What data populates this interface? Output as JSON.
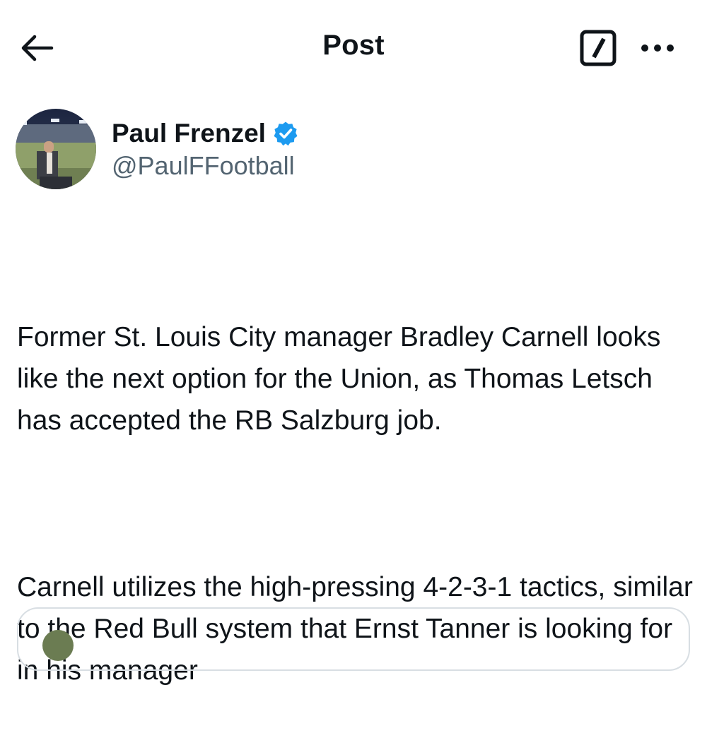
{
  "header": {
    "title": "Post",
    "back_icon": "arrow-left-icon",
    "grok_icon": "grok-icon",
    "more_icon": "more-horizontal-icon"
  },
  "author": {
    "display_name": "Paul Frenzel",
    "handle": "@PaulFFootball",
    "verified": true,
    "verified_color": "#1d9bf0"
  },
  "post": {
    "paragraphs": [
      "Former St. Louis City manager Bradley Carnell looks like the next option for the Union, as Thomas Letsch has accepted the RB Salzburg job.",
      "Carnell utilizes the high-pressing 4-2-3-1 tactics, similar to the Red Bull system that Ernst Tanner is looking for in his manager"
    ]
  },
  "colors": {
    "text": "#0f1419",
    "secondary_text": "#536471",
    "border": "#d8dee3"
  }
}
